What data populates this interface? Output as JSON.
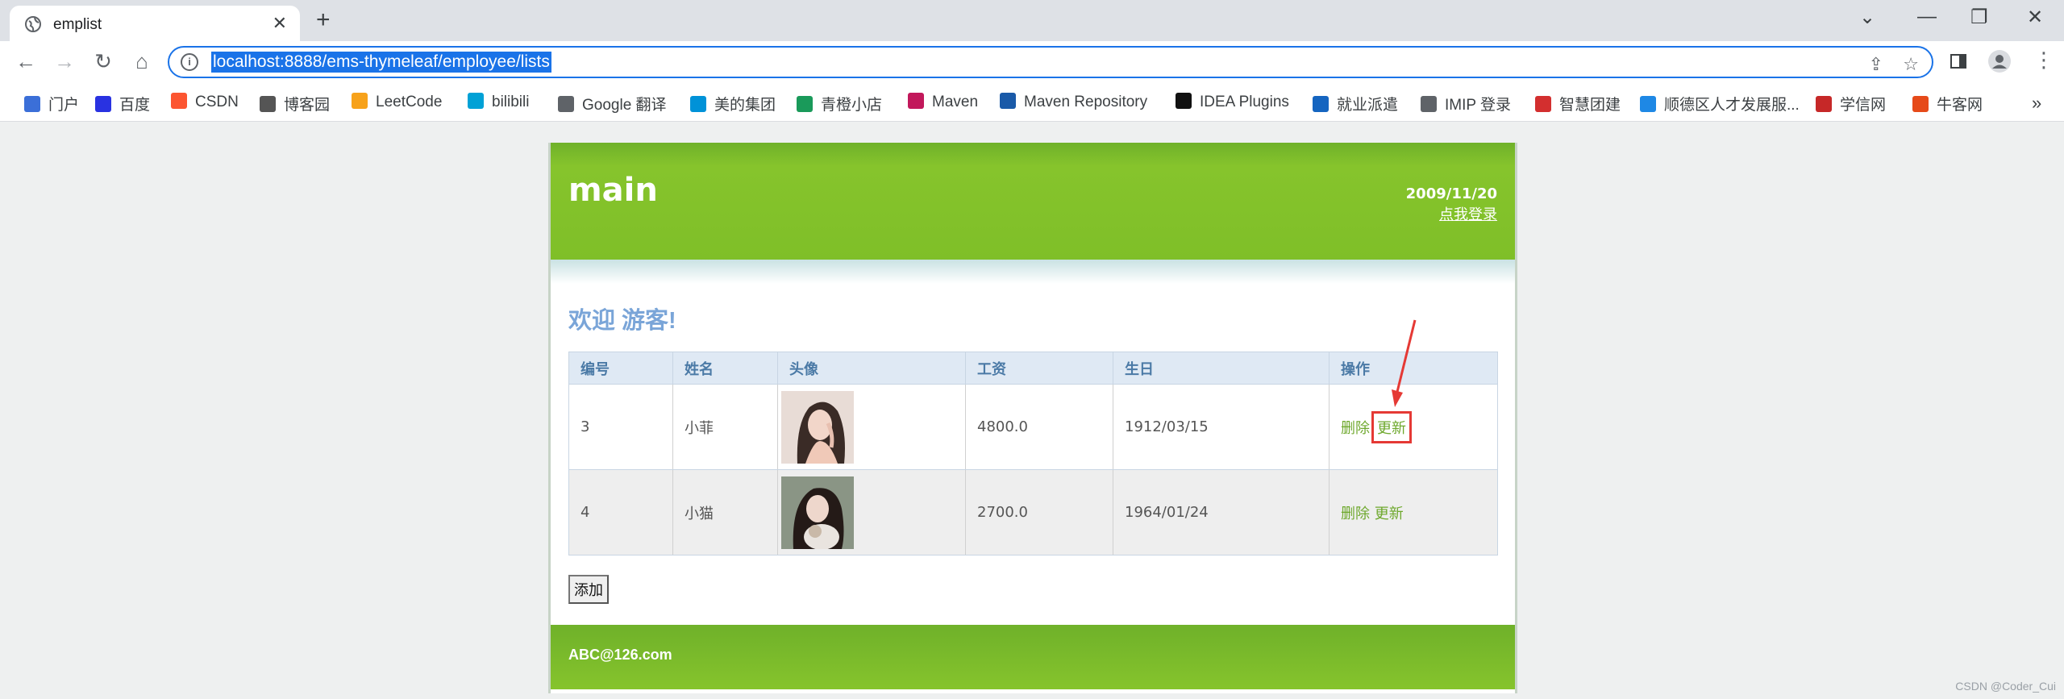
{
  "browser": {
    "tab_title": "emplist",
    "url": "localhost:8888/ems-thymeleaf/employee/lists",
    "bookmarks": [
      {
        "label": "门户",
        "color": "#3b6fd8"
      },
      {
        "label": "百度",
        "color": "#2932e1"
      },
      {
        "label": "CSDN",
        "color": "#fc5531"
      },
      {
        "label": "博客园",
        "color": "#555555"
      },
      {
        "label": "LeetCode",
        "color": "#f7a21b"
      },
      {
        "label": "bilibili",
        "color": "#00a1d6"
      },
      {
        "label": "Google 翻译",
        "color": "#5f6368"
      },
      {
        "label": "美的集团",
        "color": "#0092d8"
      },
      {
        "label": "青橙小店",
        "color": "#1a9a5a"
      },
      {
        "label": "Maven",
        "color": "#c2185b"
      },
      {
        "label": "Maven Repository",
        "color": "#1a5aa8"
      },
      {
        "label": "IDEA Plugins",
        "color": "#111111"
      },
      {
        "label": "就业派遣",
        "color": "#1565c0"
      },
      {
        "label": "IMIP 登录",
        "color": "#5f6368"
      },
      {
        "label": "智慧团建",
        "color": "#d32f2f"
      },
      {
        "label": "顺德区人才发展服...",
        "color": "#1e88e5"
      },
      {
        "label": "学信网",
        "color": "#c62828"
      },
      {
        "label": "牛客网",
        "color": "#e64a19"
      }
    ],
    "more_bookmarks": "»"
  },
  "page": {
    "logo": "main",
    "date": "2009/11/20",
    "login_link": "点我登录",
    "welcome": "欢迎 游客!",
    "table": {
      "headers": [
        "编号",
        "姓名",
        "头像",
        "工资",
        "生日",
        "操作"
      ],
      "rows": [
        {
          "id": "3",
          "name": "小菲",
          "salary": "4800.0",
          "birthday": "1912/03/15",
          "delete": "删除",
          "update": "更新"
        },
        {
          "id": "4",
          "name": "小猫",
          "salary": "2700.0",
          "birthday": "1964/01/24",
          "delete": "删除",
          "update": "更新"
        }
      ]
    },
    "add_button": "添加",
    "footer": "ABC@126.com"
  },
  "watermark": "CSDN @Coder_Cui",
  "colors": {
    "header_green": "#7fbf28",
    "welcome_blue": "#7aa5d8",
    "highlight_red": "#e53935"
  }
}
